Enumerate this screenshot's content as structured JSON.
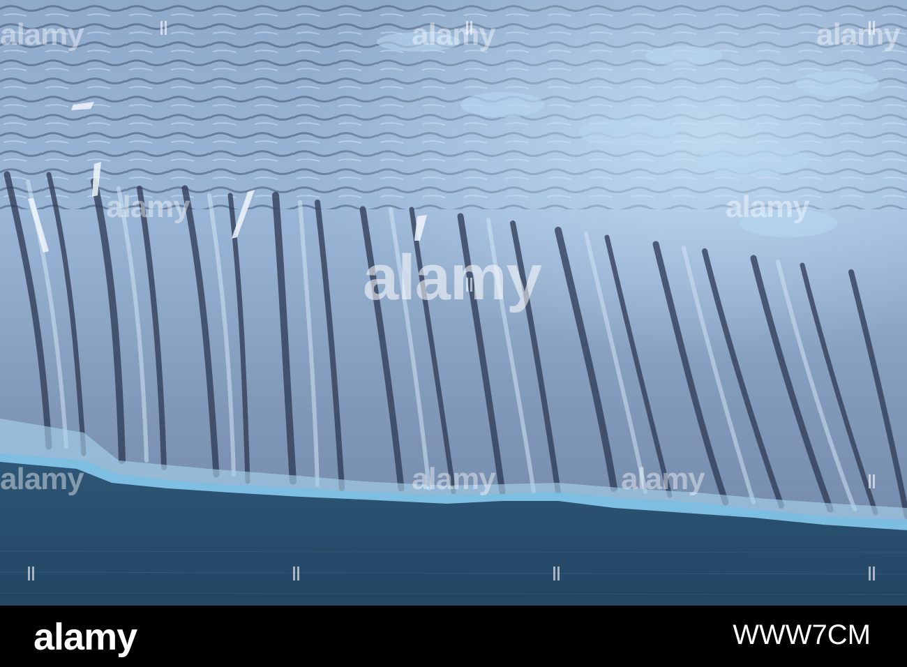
{
  "photo": {
    "subject": "glacier-terminus",
    "colors": {
      "ice_light": "#bcd6ee",
      "ice_mid": "#8aa6c8",
      "ice_dark": "#4a5a74",
      "crevasse": "#2a3550",
      "ice_edge_blue": "#7ec3e6",
      "water": "#2d5474",
      "water_dark": "#1f3f5c"
    }
  },
  "watermark": {
    "text": "alamy"
  },
  "footer": {
    "logo": "alamy",
    "image_id": "WWW7CM",
    "background": "#000000"
  }
}
